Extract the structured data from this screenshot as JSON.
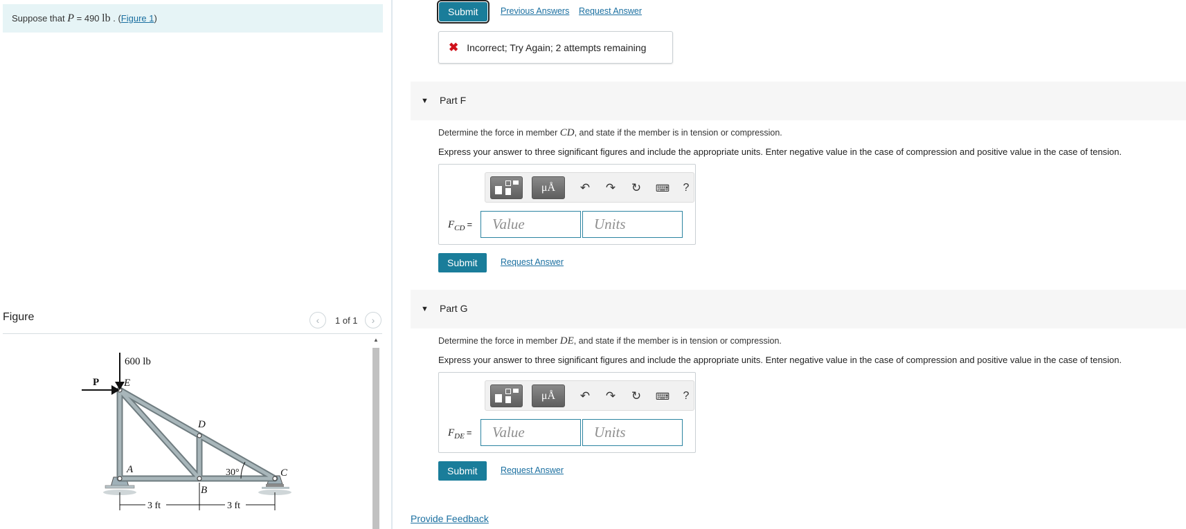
{
  "problem": {
    "text_pre": "Suppose that",
    "var": "P",
    "equals": " = 490 ",
    "unit": "lb",
    "dot": " . (",
    "figure_link": "Figure 1",
    "close": ")"
  },
  "figure_panel": {
    "title": "Figure",
    "pager_text": "1 of 1",
    "prev_icon": "chevron-left-icon",
    "next_icon": "chevron-right-icon"
  },
  "figure": {
    "load_label": "600 lb",
    "force_label": "P",
    "nodes": {
      "E": "E",
      "D": "D",
      "A": "A",
      "B": "B",
      "C": "C"
    },
    "angle_label": "30°",
    "dim1": "3 ft",
    "dim2": "3 ft"
  },
  "top_actions": {
    "submit": "Submit",
    "previous_answers": "Previous Answers",
    "request_answer": "Request Answer"
  },
  "feedback": {
    "icon": "x-icon",
    "message": "Incorrect; Try Again; 2 attempts remaining"
  },
  "parts": [
    {
      "label": "Part F",
      "question_pre": "Determine the force in member ",
      "member": "CD",
      "question_post": ", and state if the member is in tension or compression.",
      "instructions": "Express your answer to three significant figures and include the appropriate units. Enter negative value in the case of compression and positive value in the case of tension.",
      "var_main": "F",
      "var_sub": "CD",
      "eq": "=",
      "value_placeholder": "Value",
      "units_placeholder": "Units",
      "submit": "Submit",
      "request_answer": "Request Answer"
    },
    {
      "label": "Part G",
      "question_pre": "Determine the force in member ",
      "member": "DE",
      "question_post": ", and state if the member is in tension or compression.",
      "instructions": "Express your answer to three significant figures and include the appropriate units. Enter negative value in the case of compression and positive value in the case of tension.",
      "var_main": "F",
      "var_sub": "DE",
      "eq": "=",
      "value_placeholder": "Value",
      "units_placeholder": "Units",
      "submit": "Submit",
      "request_answer": "Request Answer"
    }
  ],
  "toolbar": {
    "units_label": "μÅ",
    "help_label": "?",
    "icons": [
      "templates-icon",
      "units-icon",
      "undo-icon",
      "redo-icon",
      "reset-icon",
      "keyboard-icon",
      "help-icon"
    ]
  },
  "footer": {
    "provide_feedback": "Provide Feedback"
  }
}
